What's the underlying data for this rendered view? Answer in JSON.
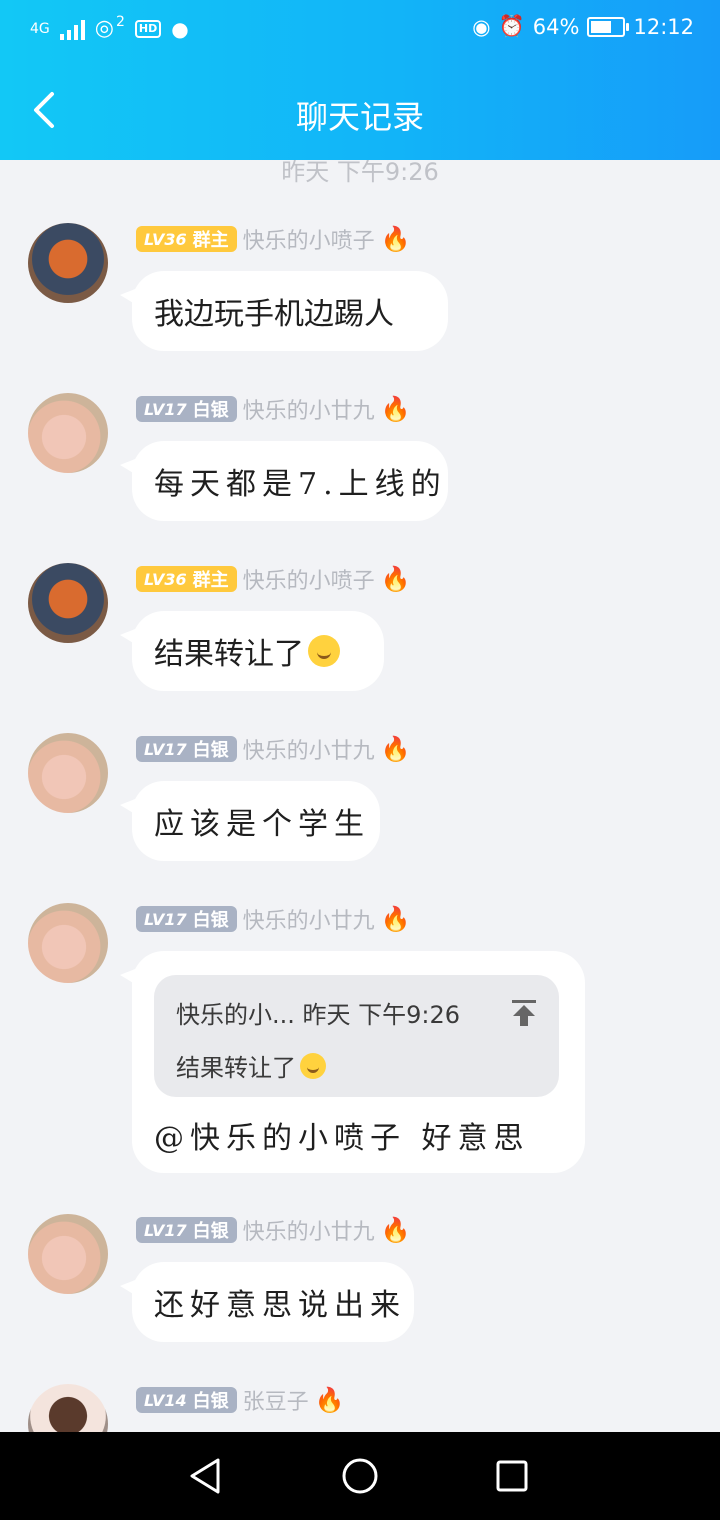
{
  "status_bar": {
    "network": "4G",
    "wifi_badge": "2",
    "hd": "HD",
    "battery": "64%",
    "battery_level": 0.64,
    "time": "12:12"
  },
  "header": {
    "title": "聊天记录"
  },
  "chat": {
    "time_divider": "昨天 下午9:26",
    "messages": [
      {
        "lv": "LV36",
        "role": "群主",
        "name": "快乐的小喷子",
        "text": "我边玩手机边踢人"
      },
      {
        "lv": "LV17",
        "role": "白银",
        "name": "快乐的小廿九",
        "text": "每天都是7.上线的"
      },
      {
        "lv": "LV36",
        "role": "群主",
        "name": "快乐的小喷子",
        "text": "结果转让了"
      },
      {
        "lv": "LV17",
        "role": "白银",
        "name": "快乐的小廿九",
        "text": "应该是个学生"
      },
      {
        "lv": "LV17",
        "role": "白银",
        "name": "快乐的小廿九",
        "quote_header": "快乐的小... 昨天 下午9:26",
        "quote_text": "结果转让了",
        "text": "@快乐的小喷子 好意思"
      },
      {
        "lv": "LV17",
        "role": "白银",
        "name": "快乐的小廿九",
        "text": "还好意思说出来"
      },
      {
        "lv": "LV14",
        "role": "白银",
        "name": "张豆子"
      }
    ]
  }
}
